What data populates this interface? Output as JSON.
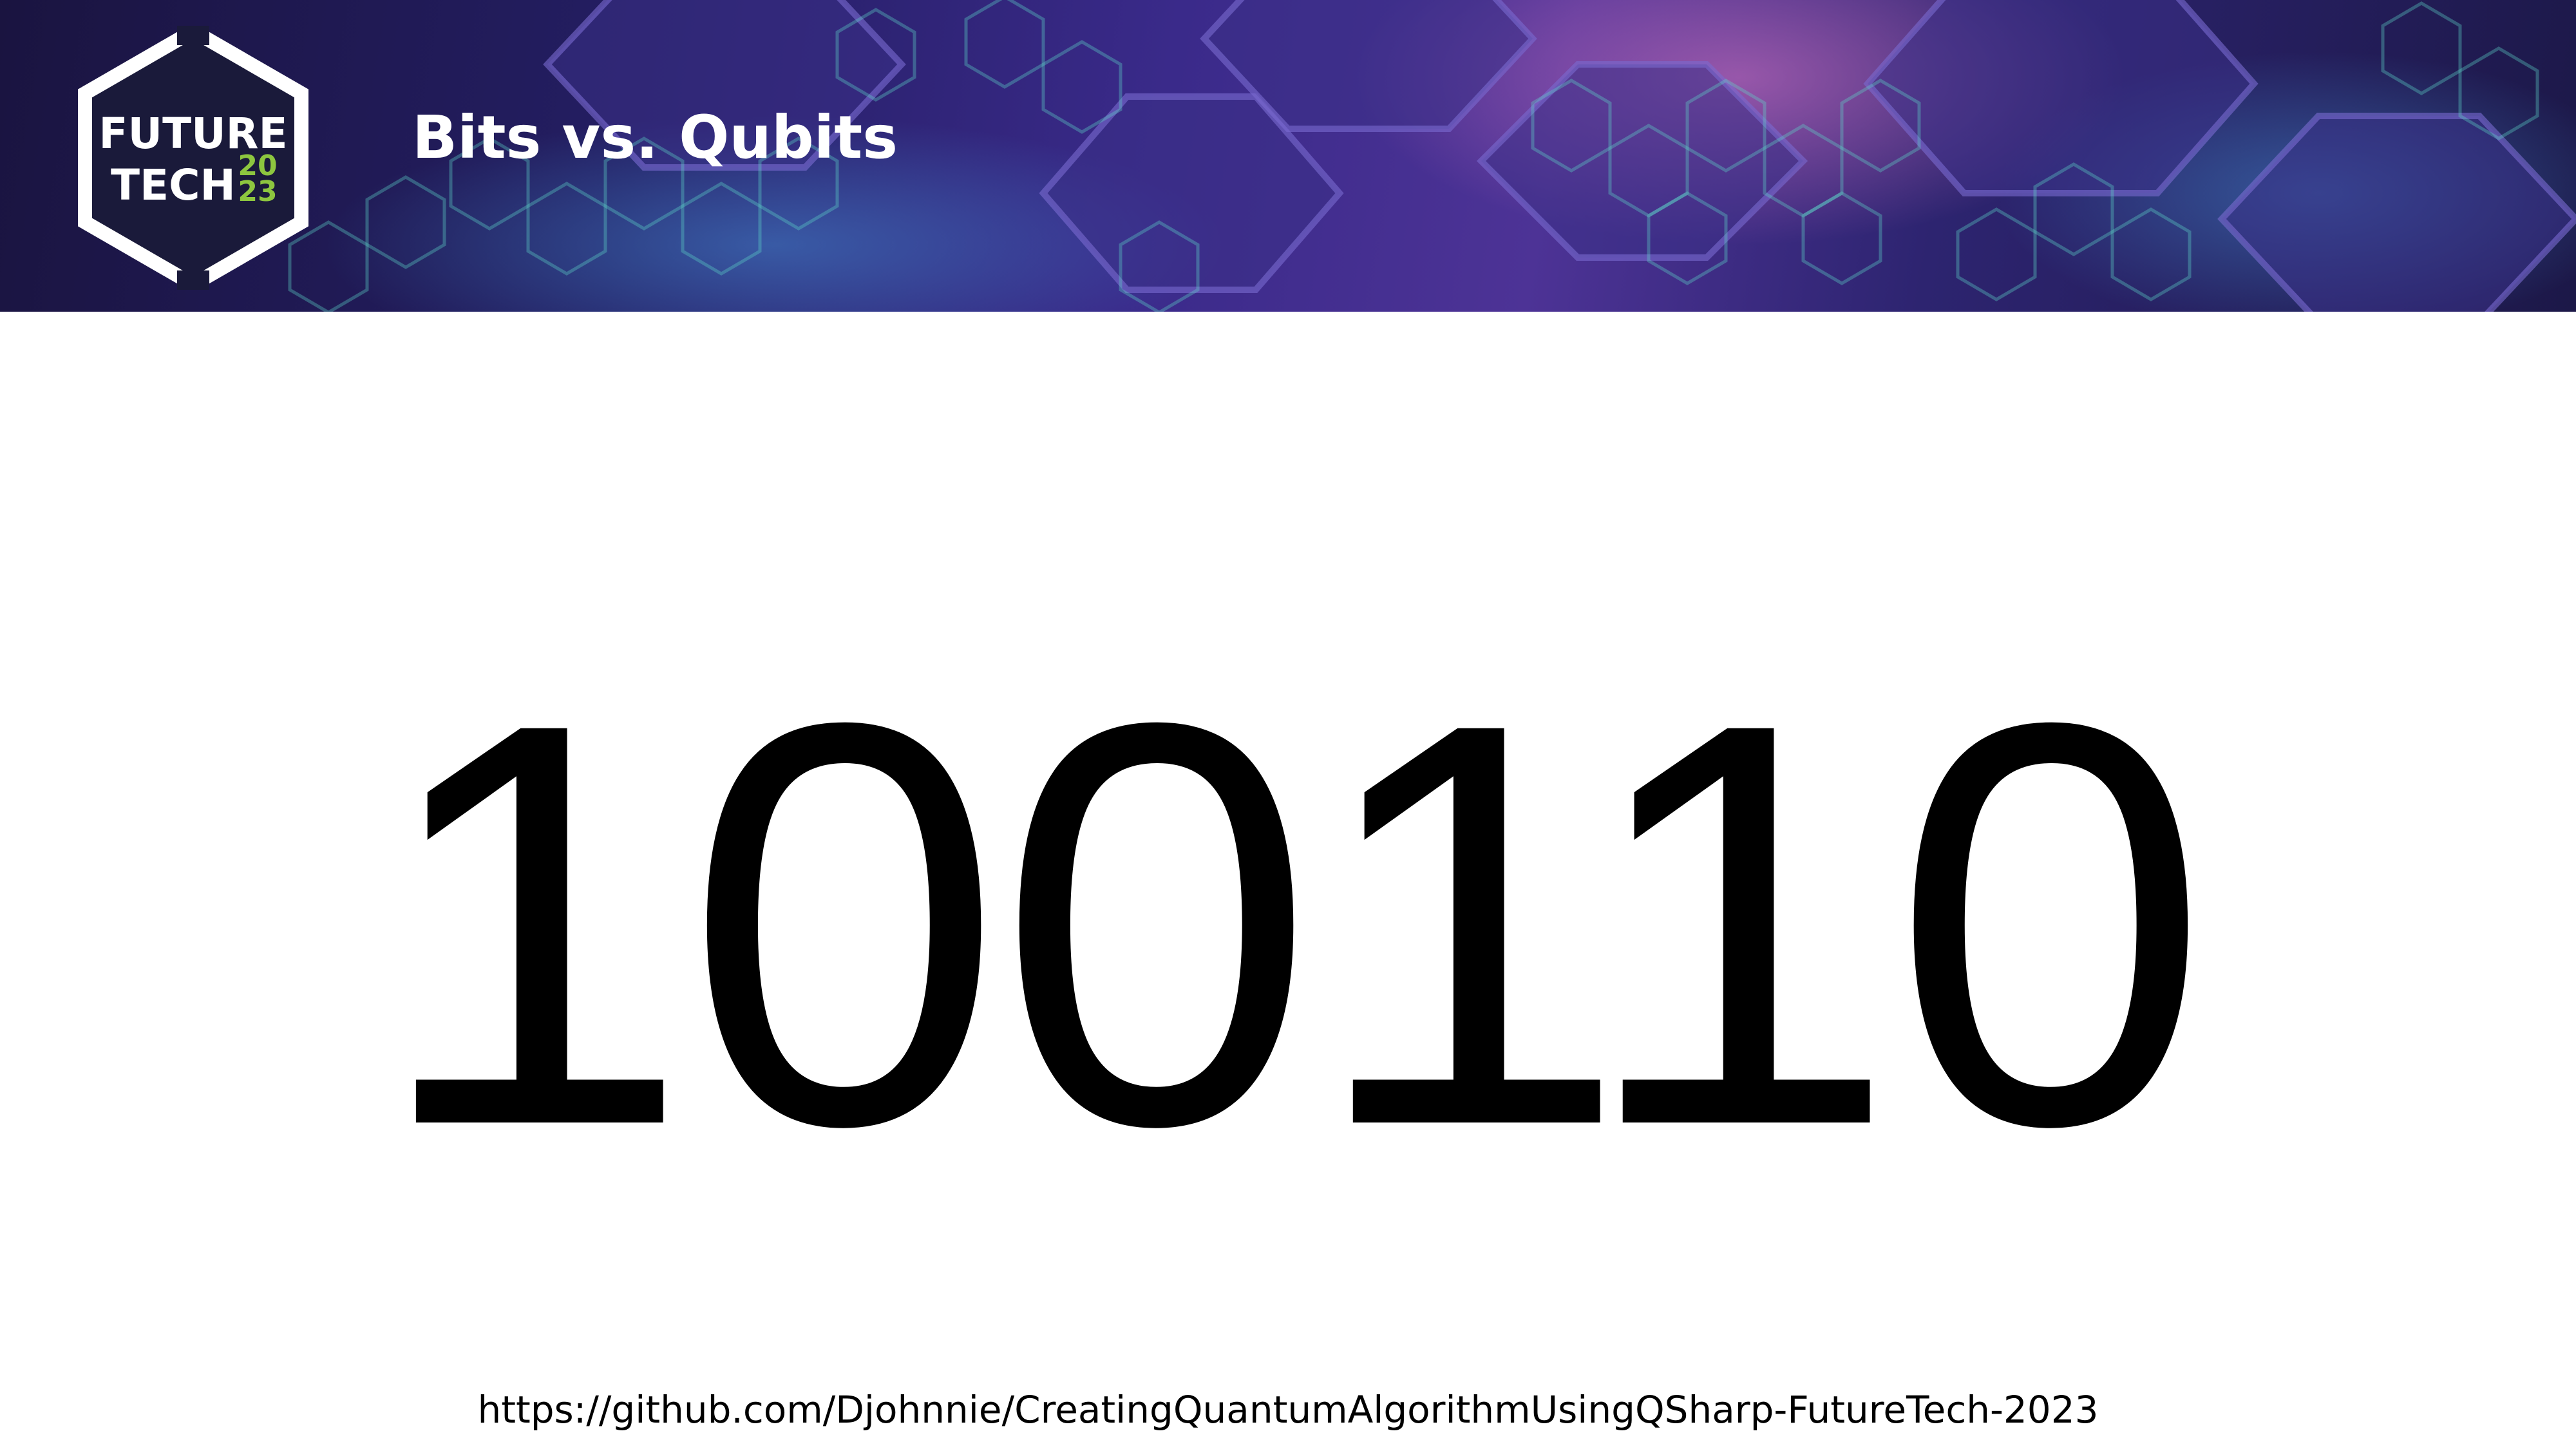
{
  "header": {
    "title": "Bits vs. Qubits",
    "logo": {
      "line1": "FUTURE",
      "line2": "TECH",
      "year_top": "20",
      "year_bottom": "23",
      "year_color": "#8dc63f"
    }
  },
  "main": {
    "number": "100110"
  },
  "footer": {
    "url": "https://github.com/Djohnnie/CreatingQuantumAlgorithmUsingQSharp-FutureTech-2023"
  },
  "colors": {
    "banner_dark": "#1a1440",
    "banner_purple": "#4d3396",
    "hex_glow": "#5fd6c8",
    "text": "#000000"
  }
}
